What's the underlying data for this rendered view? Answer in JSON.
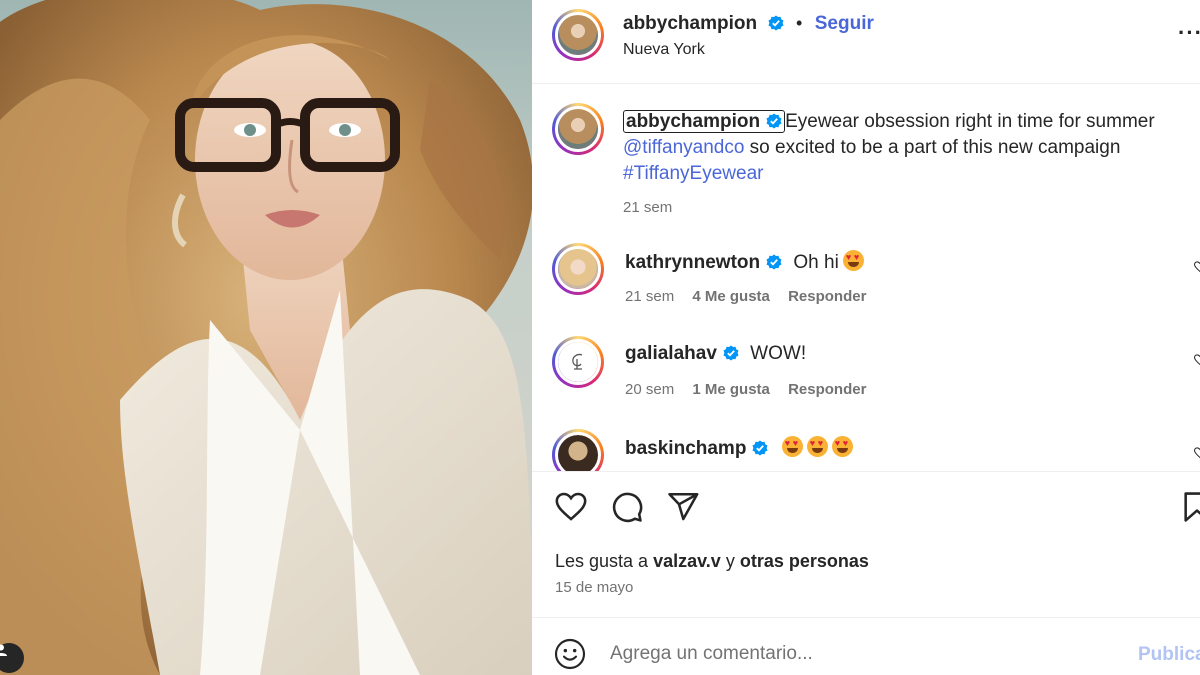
{
  "post": {
    "author": "abbychampion",
    "follow_label": "Seguir",
    "dot": "•",
    "location": "Nueva York",
    "more_label": "···"
  },
  "caption": {
    "username": "abbychampion",
    "text_part1": "Eyewear obsession right in time for summer ",
    "mention": "@tiffanyandco",
    "text_part2": " so excited to be a part of this new campaign ",
    "hashtag": "#TiffanyEyewear",
    "age": "21 sem"
  },
  "comments": [
    {
      "username": "kathrynnewton",
      "text": "Oh hi",
      "emoji_count": 1,
      "age": "21 sem",
      "likes": "4 Me gusta",
      "reply": "Responder"
    },
    {
      "username": "galialahav",
      "text": "WOW!",
      "emoji_count": 0,
      "age": "20 sem",
      "likes": "1 Me gusta",
      "reply": "Responder"
    },
    {
      "username": "baskinchamp",
      "text": "",
      "emoji_count": 3,
      "age": "",
      "likes": "",
      "reply": ""
    }
  ],
  "likes": {
    "prefix": "Les gusta a ",
    "user": "valzav.v",
    "middle": " y ",
    "others": "otras personas"
  },
  "date": "15 de mayo",
  "comment_box": {
    "placeholder": "Agrega un comentario...",
    "publish_label": "Publicar"
  },
  "icons": {
    "verified": "verified-badge-icon",
    "heart": "heart-icon",
    "comment": "comment-icon",
    "share": "share-icon",
    "save": "bookmark-icon",
    "emoji": "smile-icon",
    "user": "user-icon"
  },
  "colors": {
    "link": "#4a66d8",
    "verified": "#0095f6",
    "publish_disabled": "#b2c4f4"
  }
}
